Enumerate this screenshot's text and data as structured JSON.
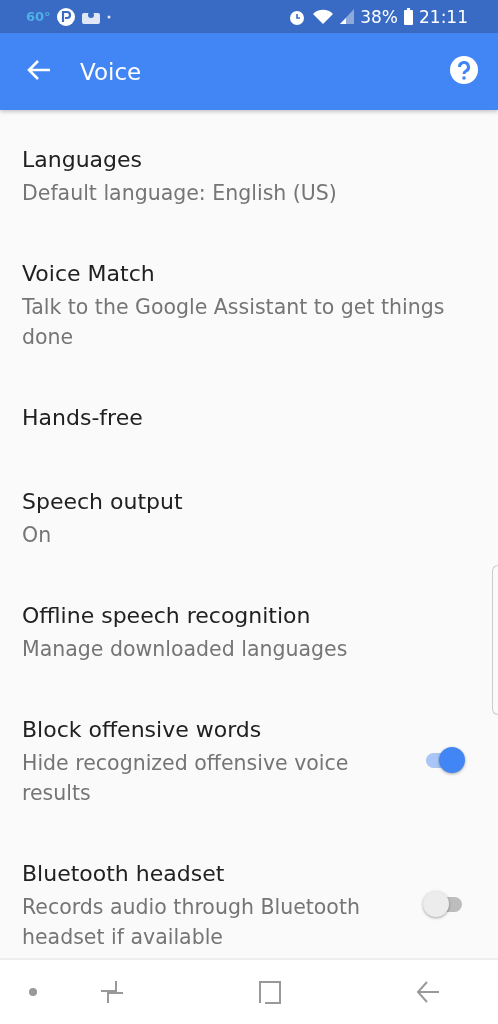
{
  "status_bar": {
    "temperature": "60°",
    "battery": "38%",
    "time": "21:11"
  },
  "app_bar": {
    "title": "Voice"
  },
  "items": [
    {
      "kind": "plain",
      "title": "Languages",
      "subtitle": "Default language: English (US)"
    },
    {
      "kind": "plain",
      "title": "Voice Match",
      "subtitle": "Talk to the Google Assistant to get things done"
    },
    {
      "kind": "plain",
      "title": "Hands-free"
    },
    {
      "kind": "plain",
      "title": "Speech output",
      "subtitle": "On"
    },
    {
      "kind": "plain",
      "title": "Offline speech recognition",
      "subtitle": "Manage downloaded languages"
    },
    {
      "kind": "toggle",
      "title": "Block offensive words",
      "subtitle": "Hide recognized offensive voice results",
      "on": true
    },
    {
      "kind": "toggle",
      "title": "Bluetooth headset",
      "subtitle": "Records audio through Bluetooth headset if available",
      "on": false
    }
  ]
}
